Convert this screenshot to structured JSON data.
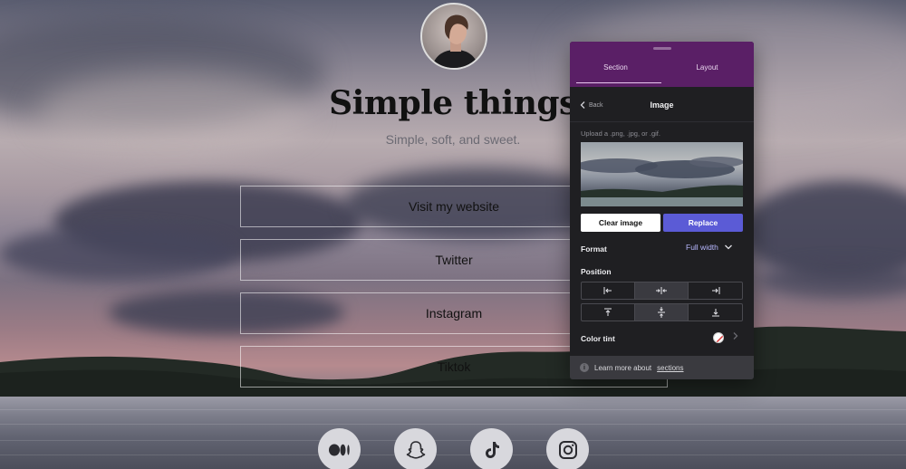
{
  "page": {
    "title": "Simple things",
    "subtitle": "Simple, soft, and sweet.",
    "links": [
      {
        "label": "Visit my website"
      },
      {
        "label": "Twitter"
      },
      {
        "label": "Instagram"
      },
      {
        "label": "Tiktok"
      }
    ],
    "socials": [
      {
        "icon": "medium-icon"
      },
      {
        "icon": "snapchat-icon"
      },
      {
        "icon": "tiktok-icon"
      },
      {
        "icon": "instagram-icon"
      }
    ]
  },
  "panel": {
    "tabs": [
      {
        "label": "Section",
        "active": true
      },
      {
        "label": "Layout",
        "active": false
      }
    ],
    "back_label": "Back",
    "title": "Image",
    "upload_hint": "Upload a .png, .jpg, or .gif.",
    "clear_label": "Clear image",
    "replace_label": "Replace",
    "format_label": "Format",
    "format_value": "Full width",
    "position_label": "Position",
    "color_tint_label": "Color tint",
    "footer_text": "Learn more about",
    "footer_link": "sections",
    "colors": {
      "header": "#5a1f66",
      "accent": "#5b5bd6",
      "background": "#1f1f22"
    }
  }
}
